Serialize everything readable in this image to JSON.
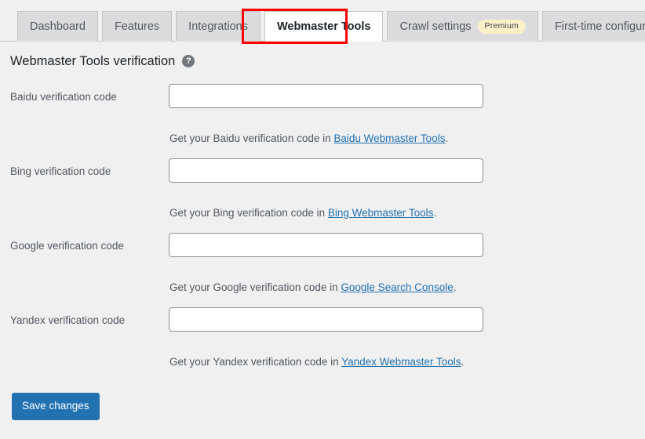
{
  "tabs": [
    {
      "label": "Dashboard",
      "active": false,
      "badge": null
    },
    {
      "label": "Features",
      "active": false,
      "badge": null
    },
    {
      "label": "Integrations",
      "active": false,
      "badge": null
    },
    {
      "label": "Webmaster Tools",
      "active": true,
      "badge": null
    },
    {
      "label": "Crawl settings",
      "active": false,
      "badge": "Premium"
    },
    {
      "label": "First-time configuration",
      "active": false,
      "badge": null
    }
  ],
  "heading": {
    "title": "Webmaster Tools verification",
    "help_icon": "help-circle-icon",
    "help_glyph": "?"
  },
  "fields": [
    {
      "label": "Baidu verification code",
      "value": "",
      "placeholder": "",
      "desc_prefix": "Get your Baidu verification code in ",
      "link_text": "Baidu Webmaster Tools",
      "desc_suffix": "."
    },
    {
      "label": "Bing verification code",
      "value": "",
      "placeholder": "",
      "desc_prefix": "Get your Bing verification code in ",
      "link_text": "Bing Webmaster Tools",
      "desc_suffix": "."
    },
    {
      "label": "Google verification code",
      "value": "",
      "placeholder": "",
      "desc_prefix": "Get your Google verification code in ",
      "link_text": "Google Search Console",
      "desc_suffix": "."
    },
    {
      "label": "Yandex verification code",
      "value": "",
      "placeholder": "",
      "desc_prefix": "Get your Yandex verification code in ",
      "link_text": "Yandex Webmaster Tools",
      "desc_suffix": "."
    }
  ],
  "actions": {
    "save_label": "Save changes"
  },
  "colors": {
    "page_background": "#f0f0f1",
    "tab_inactive_background": "#dcdcde",
    "tab_active_background": "#ffffff",
    "tab_border": "#c3c4c7",
    "link": "#2271b1",
    "primary_button": "#2271b1",
    "premium_badge_background": "#fcf0c8",
    "highlight_outline": "#ff0000",
    "help_icon": "#72777c"
  }
}
